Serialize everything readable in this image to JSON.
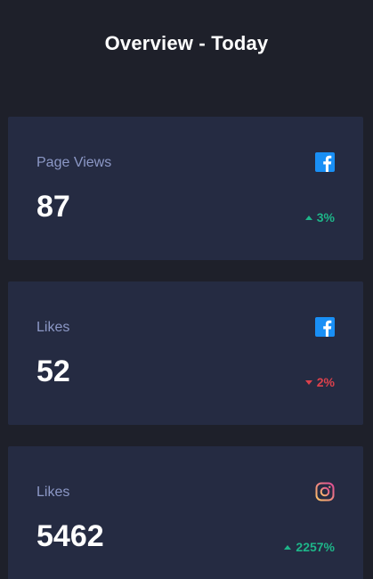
{
  "header": {
    "title": "Overview - Today"
  },
  "cards": [
    {
      "label": "Page Views",
      "value": "87",
      "change": "3%",
      "direction": "up",
      "icon": "facebook-icon"
    },
    {
      "label": "Likes",
      "value": "52",
      "change": "2%",
      "direction": "down",
      "icon": "facebook-icon"
    },
    {
      "label": "Likes",
      "value": "5462",
      "change": "2257%",
      "direction": "up",
      "icon": "instagram-icon"
    }
  ],
  "colors": {
    "background": "#1e202a",
    "card": "#252b42",
    "positive": "#1eb589",
    "negative": "#dc414c",
    "facebook": "#198ff5",
    "label": "#8c98c6"
  }
}
